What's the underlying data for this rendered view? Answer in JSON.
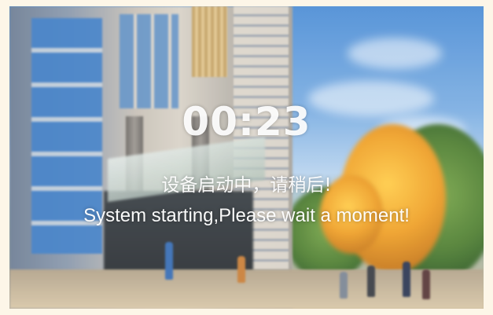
{
  "boot_screen": {
    "countdown": "00:23",
    "message_cn": "设备启动中，请稍后!",
    "message_en": "System starting,Please wait a moment!"
  },
  "colors": {
    "text": "#ffffff",
    "sky": "#4f8fd6",
    "autumn_tree": "#f0a22a",
    "bezel": "#fdf6e8"
  }
}
